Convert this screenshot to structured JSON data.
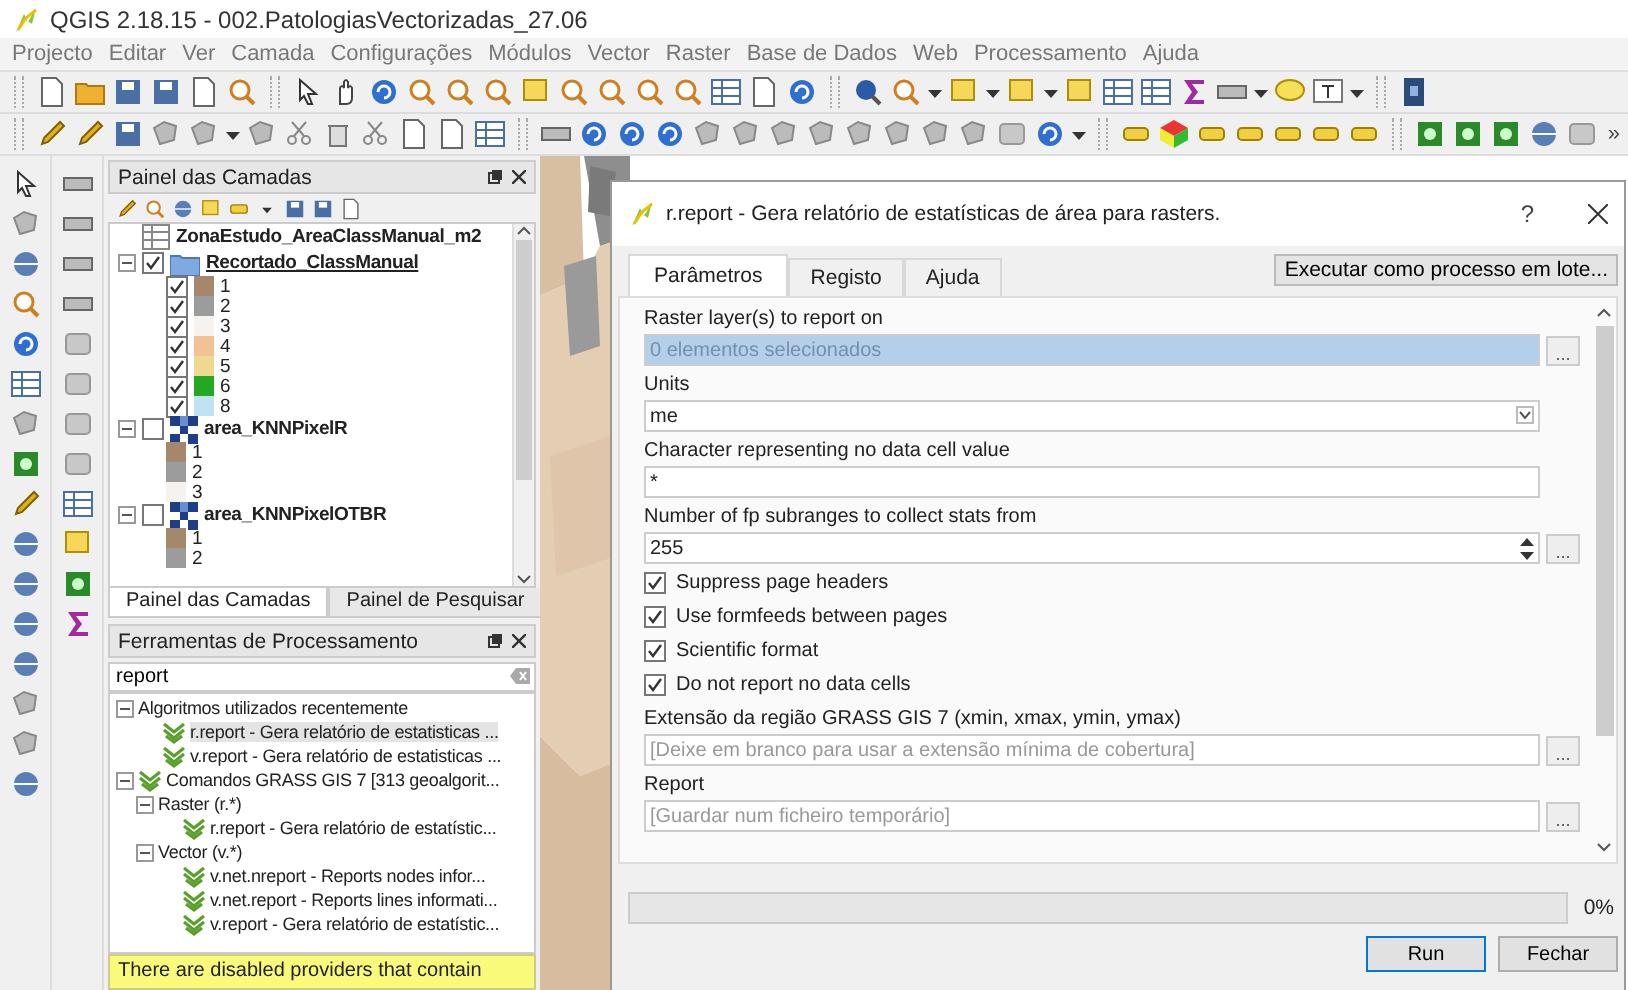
{
  "window": {
    "title": "QGIS 2.18.15 - 002.PatologiasVectorizadas_27.06"
  },
  "menu": [
    "Projecto",
    "Editar",
    "Ver",
    "Camada",
    "Configurações",
    "Módulos",
    "Vector",
    "Raster",
    "Base de Dados",
    "Web",
    "Processamento",
    "Ajuda"
  ],
  "toolbar_overflow": "»",
  "layers_panel": {
    "title": "Painel das Camadas",
    "layers": [
      {
        "name": "ZonaEstudo_AreaClassManual_m2",
        "kind": "table",
        "current": false
      },
      {
        "name": "Recortado_ClassManual",
        "kind": "vector",
        "checked": true,
        "expanded": true,
        "current": true,
        "classes": [
          {
            "label": "1",
            "color": "#a5876c",
            "checked": true
          },
          {
            "label": "2",
            "color": "#9c9c9c",
            "checked": true
          },
          {
            "label": "3",
            "color": "#f6f3ee",
            "checked": true
          },
          {
            "label": "4",
            "color": "#f2c194",
            "checked": true
          },
          {
            "label": "5",
            "color": "#eed992",
            "checked": true
          },
          {
            "label": "6",
            "color": "#22a822",
            "checked": true
          },
          {
            "label": "8",
            "color": "#bfe3f2",
            "checked": true
          }
        ]
      },
      {
        "name": "area_KNNPixelR",
        "kind": "raster",
        "checked": false,
        "expanded": true,
        "current": false,
        "classes": [
          {
            "label": "1",
            "color": "#a5876c"
          },
          {
            "label": "2",
            "color": "#9c9c9c"
          },
          {
            "label": "3",
            "color": "#f6f3ee"
          }
        ]
      },
      {
        "name": "area_KNNPixelOTBR",
        "kind": "raster",
        "checked": false,
        "expanded": true,
        "current": false,
        "classes": [
          {
            "label": "1",
            "color": "#a5876c"
          },
          {
            "label": "2",
            "color": "#9c9c9c"
          }
        ]
      }
    ],
    "tabs": [
      {
        "label": "Painel das Camadas",
        "selected": true
      },
      {
        "label": "Painel de Pesquisar",
        "selected": false
      }
    ]
  },
  "processing_panel": {
    "title": "Ferramentas de Processamento",
    "search": {
      "value": "report"
    },
    "tree": [
      {
        "label": "Algoritmos utilizados recentemente",
        "expanded": true,
        "children": [
          {
            "label": "r.report - Gera relatório de estatisticas ...",
            "kind": "algorithm",
            "selected": true
          },
          {
            "label": "v.report - Gera relatório de estatisticas ...",
            "kind": "algorithm",
            "selected": false
          }
        ]
      },
      {
        "label": "Comandos GRASS GIS 7 [313 geoalgorit...",
        "kind": "algorithm",
        "expanded": true,
        "children": [
          {
            "label": "Raster (r.*)",
            "expanded": true,
            "children": [
              {
                "label": "r.report - Gera relatório de estatístic...",
                "kind": "algorithm",
                "selected": false
              }
            ]
          },
          {
            "label": "Vector (v.*)",
            "expanded": true,
            "children": [
              {
                "label": "v.net.nreport - Reports nodes infor...",
                "kind": "algorithm",
                "selected": false
              },
              {
                "label": "v.net.report - Reports lines informati...",
                "kind": "algorithm",
                "selected": false
              },
              {
                "label": "v.report - Gera relatório de estatístic...",
                "kind": "algorithm",
                "selected": false
              }
            ]
          }
        ]
      }
    ],
    "warning": "There are disabled providers that contain"
  },
  "dialog": {
    "title": "r.report - Gera relatório de estatísticas de área para rasters.",
    "help": "?",
    "tabs": [
      {
        "label": "Parâmetros",
        "selected": true
      },
      {
        "label": "Registo",
        "selected": false
      },
      {
        "label": "Ajuda",
        "selected": false
      }
    ],
    "batch_button": "Executar como processo em lote...",
    "params": [
      {
        "kind": "multi",
        "label": "Raster layer(s) to report on",
        "value": "0 elementos selecionados",
        "button": "..."
      },
      {
        "kind": "select",
        "label": "Units",
        "value": "me"
      },
      {
        "kind": "text",
        "label": "Character representing no data cell value",
        "value": "*"
      },
      {
        "kind": "number",
        "label": "Number of fp subranges to collect stats from",
        "value": "255",
        "button": "..."
      },
      {
        "kind": "checkbox",
        "label": "Suppress page headers",
        "checked": true
      },
      {
        "kind": "checkbox",
        "label": "Use formfeeds between pages",
        "checked": true
      },
      {
        "kind": "checkbox",
        "label": "Scientific format",
        "checked": true
      },
      {
        "kind": "checkbox",
        "label": "Do not report no data cells",
        "checked": true
      },
      {
        "kind": "text",
        "label": "Extensão da região GRASS GIS 7 (xmin, xmax, ymin, ymax)",
        "placeholder": "[Deixe em branco para usar a extensão mínima de cobertura]",
        "button": "..."
      },
      {
        "kind": "text",
        "label": "Report",
        "placeholder": "[Guardar num ficheiro temporário]",
        "button": "..."
      }
    ],
    "progress": {
      "level": 0,
      "reading": "0%"
    },
    "buttons": [
      {
        "label": "Run",
        "default": true
      },
      {
        "label": "Fechar",
        "default": false
      }
    ]
  }
}
